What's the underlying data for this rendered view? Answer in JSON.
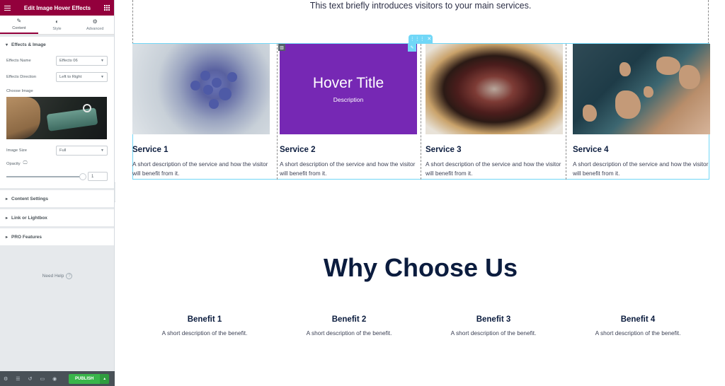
{
  "panel": {
    "title": "Edit Image Hover Effects",
    "tabs": [
      {
        "label": "Content",
        "icon": "pencil-icon"
      },
      {
        "label": "Style",
        "icon": "half-circle-icon"
      },
      {
        "label": "Advanced",
        "icon": "gear-icon"
      }
    ],
    "section_title": "Effects & Image",
    "effects_name_label": "Effects Name",
    "effects_name_value": "Effects 06",
    "effects_direction_label": "Effects Direction",
    "effects_direction_value": "Left to Right",
    "choose_image_label": "Choose Image",
    "image_size_label": "Image Size",
    "image_size_value": "Full",
    "opacity_label": "Opacity",
    "opacity_value": "1",
    "opacity_fraction": 1,
    "collapsed_sections": [
      "Content Settings",
      "Link or Lightbox",
      "PRO Features"
    ],
    "need_help": "Need Help",
    "publish_label": "PUBLISH"
  },
  "canvas": {
    "intro": "This text briefly introduces visitors to your main services.",
    "services": [
      {
        "title": "Service 1",
        "desc": "A short description of the service and how the visitor will benefit from it."
      },
      {
        "title": "Service 2",
        "desc": "A short description of the service and how the visitor will benefit from it."
      },
      {
        "title": "Service 3",
        "desc": "A short description of the service and how the visitor will benefit from it."
      },
      {
        "title": "Service 4",
        "desc": "A short description of the service and how the visitor will benefit from it."
      }
    ],
    "hover_title": "Hover Title",
    "hover_desc": "Description",
    "why_title": "Why Choose Us",
    "benefits": [
      {
        "title": "Benefit 1",
        "desc": "A short description of the benefit."
      },
      {
        "title": "Benefit 2",
        "desc": "A short description of the benefit."
      },
      {
        "title": "Benefit 3",
        "desc": "A short description of the benefit."
      },
      {
        "title": "Benefit 4",
        "desc": "A short description of the benefit."
      }
    ]
  },
  "colors": {
    "panel_header": "#93003c",
    "publish": "#39b54a",
    "selection_outline": "#71d7f7",
    "hover_overlay": "#7628b4",
    "heading": "#0b1c3e"
  }
}
